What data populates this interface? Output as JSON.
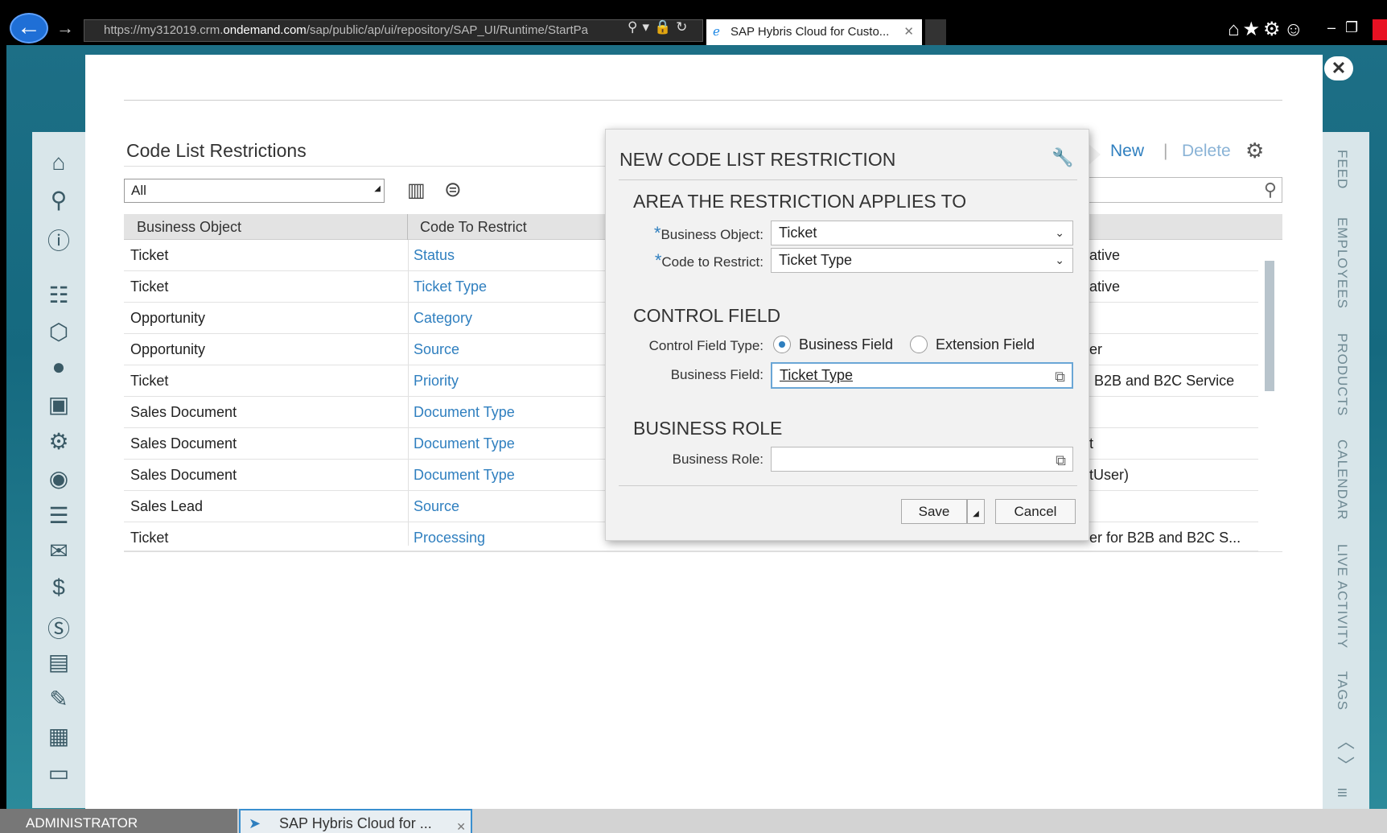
{
  "browser": {
    "url_prefix": "https://my312019.crm.",
    "url_domain": "ondemand.com",
    "url_path": "/sap/public/ap/ui/repository/SAP_UI/Runtime/StartPa",
    "tab_title": "SAP Hybris Cloud for Custo..."
  },
  "page": {
    "title": "Code List Restrictions",
    "actions": {
      "new": "New",
      "sep": "|",
      "delete": "Delete"
    },
    "filter_value": "All",
    "columns": [
      "Business Object",
      "Code To Restrict"
    ],
    "rows": [
      {
        "business_object": "Ticket",
        "code": "Status",
        "extra": "ative"
      },
      {
        "business_object": "Ticket",
        "code": "Ticket Type",
        "extra": "ative"
      },
      {
        "business_object": "Opportunity",
        "code": "Category",
        "extra": ""
      },
      {
        "business_object": "Opportunity",
        "code": "Source",
        "extra": "er"
      },
      {
        "business_object": "Ticket",
        "code": "Priority",
        "extra": "B2B and B2C Service"
      },
      {
        "business_object": "Sales Document",
        "code": "Document Type",
        "extra": ""
      },
      {
        "business_object": "Sales Document",
        "code": "Document Type",
        "extra": "t"
      },
      {
        "business_object": "Sales Document",
        "code": "Document Type",
        "extra": "tUser)"
      },
      {
        "business_object": "Sales Lead",
        "code": "Source",
        "extra": ""
      },
      {
        "business_object": "Ticket",
        "code": "Processing",
        "extra": "er for B2B and B2C S..."
      }
    ]
  },
  "dialog": {
    "title": "NEW CODE LIST RESTRICTION",
    "section_area": "AREA THE RESTRICTION APPLIES TO",
    "label_business_object": "Business Object:",
    "value_business_object": "Ticket",
    "label_code_to_restrict": "Code to Restrict:",
    "value_code_to_restrict": "Ticket Type",
    "section_control": "CONTROL FIELD",
    "label_control_field_type": "Control Field Type:",
    "radio_business_field": "Business Field",
    "radio_extension_field": "Extension Field",
    "selected_control_field_type": "Business Field",
    "label_business_field": "Business Field:",
    "value_business_field": "Ticket Type",
    "section_role": "BUSINESS ROLE",
    "label_business_role": "Business Role:",
    "value_business_role": "",
    "save": "Save",
    "cancel": "Cancel",
    "required_marker": "*"
  },
  "right_nav": [
    "FEED",
    "EMPLOYEES",
    "PRODUCTS",
    "CALENDAR",
    "LIVE ACTIVITY",
    "TAGS"
  ],
  "taskbar": {
    "user": "ADMINISTRATOR",
    "task": "SAP Hybris Cloud for ..."
  },
  "icons": {
    "left_nav": [
      "home-icon",
      "search-icon",
      "alert-icon",
      "org-chart-icon",
      "cube-icon",
      "circle-icon",
      "analysis-icon",
      "gear-icon",
      "user-circle-icon",
      "user-list-icon",
      "mail-icon",
      "money-in-icon",
      "dollar-icon",
      "person-doc-icon",
      "edit-doc-icon",
      "calendar-grid-icon",
      "price-tag-icon"
    ]
  },
  "colors": {
    "link": "#2f7fbf",
    "app_bg": "#1d6f86",
    "dialog_bg": "#f2f2f2"
  }
}
